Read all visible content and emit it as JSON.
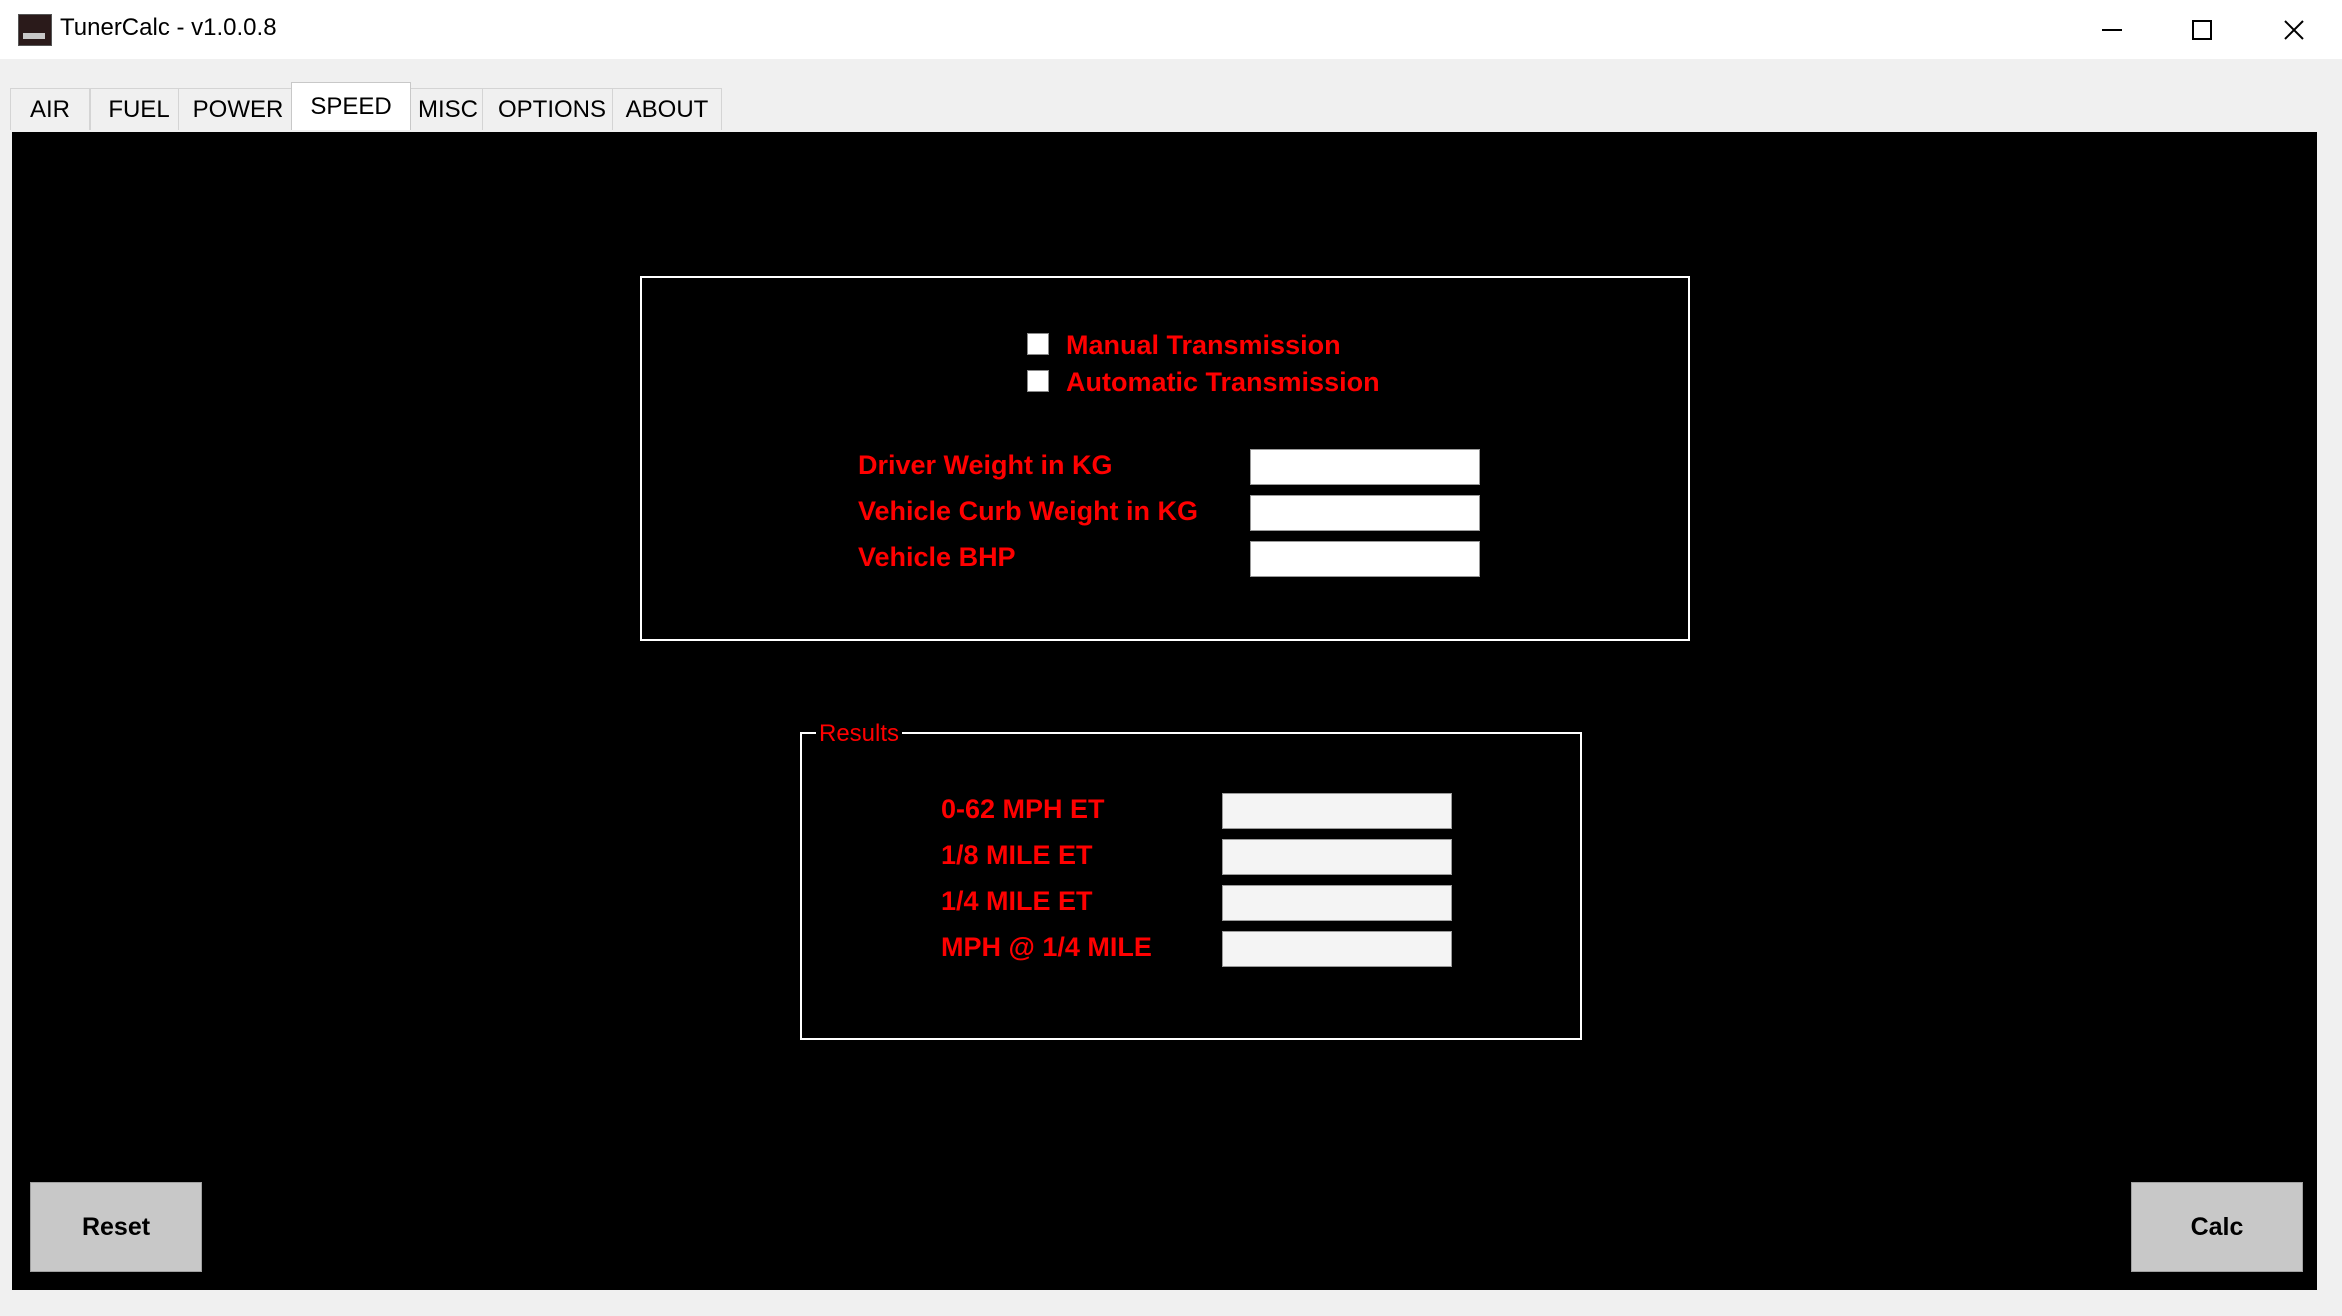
{
  "window": {
    "title": "TunerCalc - v1.0.0.8",
    "icon": "app-icon",
    "controls": [
      "minimize-icon",
      "maximize-icon",
      "close-icon"
    ]
  },
  "tabs": [
    {
      "label": "AIR"
    },
    {
      "label": "FUEL"
    },
    {
      "label": "POWER"
    },
    {
      "label": "SPEED",
      "active": true
    },
    {
      "label": "MISC"
    },
    {
      "label": "OPTIONS"
    },
    {
      "label": "ABOUT"
    }
  ],
  "inputs": {
    "manual_transmission": {
      "label": "Manual Transmission",
      "checked": false
    },
    "automatic_transmission": {
      "label": "Automatic Transmission",
      "checked": false
    },
    "driver_weight": {
      "label": "Driver Weight in KG",
      "value": ""
    },
    "curb_weight": {
      "label": "Vehicle Curb Weight in KG",
      "value": ""
    },
    "bhp": {
      "label": "Vehicle BHP",
      "value": ""
    }
  },
  "results": {
    "title": "Results",
    "et_0_62": {
      "label": "0-62 MPH ET",
      "value": ""
    },
    "eighth_mile": {
      "label": "1/8 MILE ET",
      "value": ""
    },
    "quarter_mile": {
      "label": "1/4 MILE ET",
      "value": ""
    },
    "mph_quarter": {
      "label": "MPH @ 1/4 MILE",
      "value": ""
    }
  },
  "buttons": {
    "reset": "Reset",
    "calc": "Calc"
  },
  "colors": {
    "panel_bg": "#000000",
    "label": "#ff0000",
    "border": "#ffffff",
    "button_bg": "#c8c8c8"
  }
}
